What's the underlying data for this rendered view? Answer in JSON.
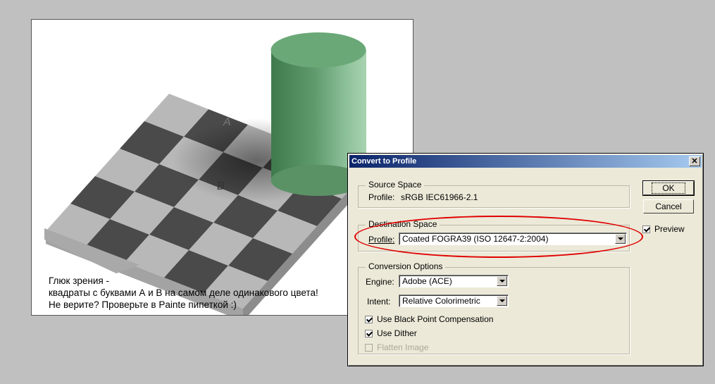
{
  "image_panel": {
    "letter_a": "A",
    "letter_b": "B",
    "caption_lines": [
      "Глюк зрения -",
      "квадраты с буквами А и В на самом деле одинакового цвета!",
      "Не верите? Проверьте в Painte пипеткой :)"
    ]
  },
  "dialog": {
    "title": "Convert to Profile",
    "close_glyph": "✕",
    "source_space": {
      "legend": "Source Space",
      "profile_label": "Profile:",
      "profile_value": "sRGB IEC61966-2.1"
    },
    "destination_space": {
      "legend": "Destination Space",
      "profile_label": "Profile:",
      "profile_value": "Coated FOGRA39 (ISO 12647-2:2004)"
    },
    "conversion_options": {
      "legend": "Conversion Options",
      "engine_label": "Engine:",
      "engine_value": "Adobe (ACE)",
      "intent_label": "Intent:",
      "intent_value": "Relative Colorimetric",
      "black_point": {
        "label": "Use Black Point Compensation",
        "checked": true
      },
      "dither": {
        "label": "Use Dither",
        "checked": true
      },
      "flatten": {
        "label": "Flatten Image",
        "checked": false,
        "disabled": true
      }
    },
    "buttons": {
      "ok": "OK",
      "cancel": "Cancel"
    },
    "preview": {
      "label": "Preview",
      "checked": true
    }
  },
  "colors": {
    "title_bar_start": "#0a246a",
    "title_bar_end": "#a6caf0",
    "highlight": "#e00000",
    "cylinder": "#5e9a6c"
  }
}
